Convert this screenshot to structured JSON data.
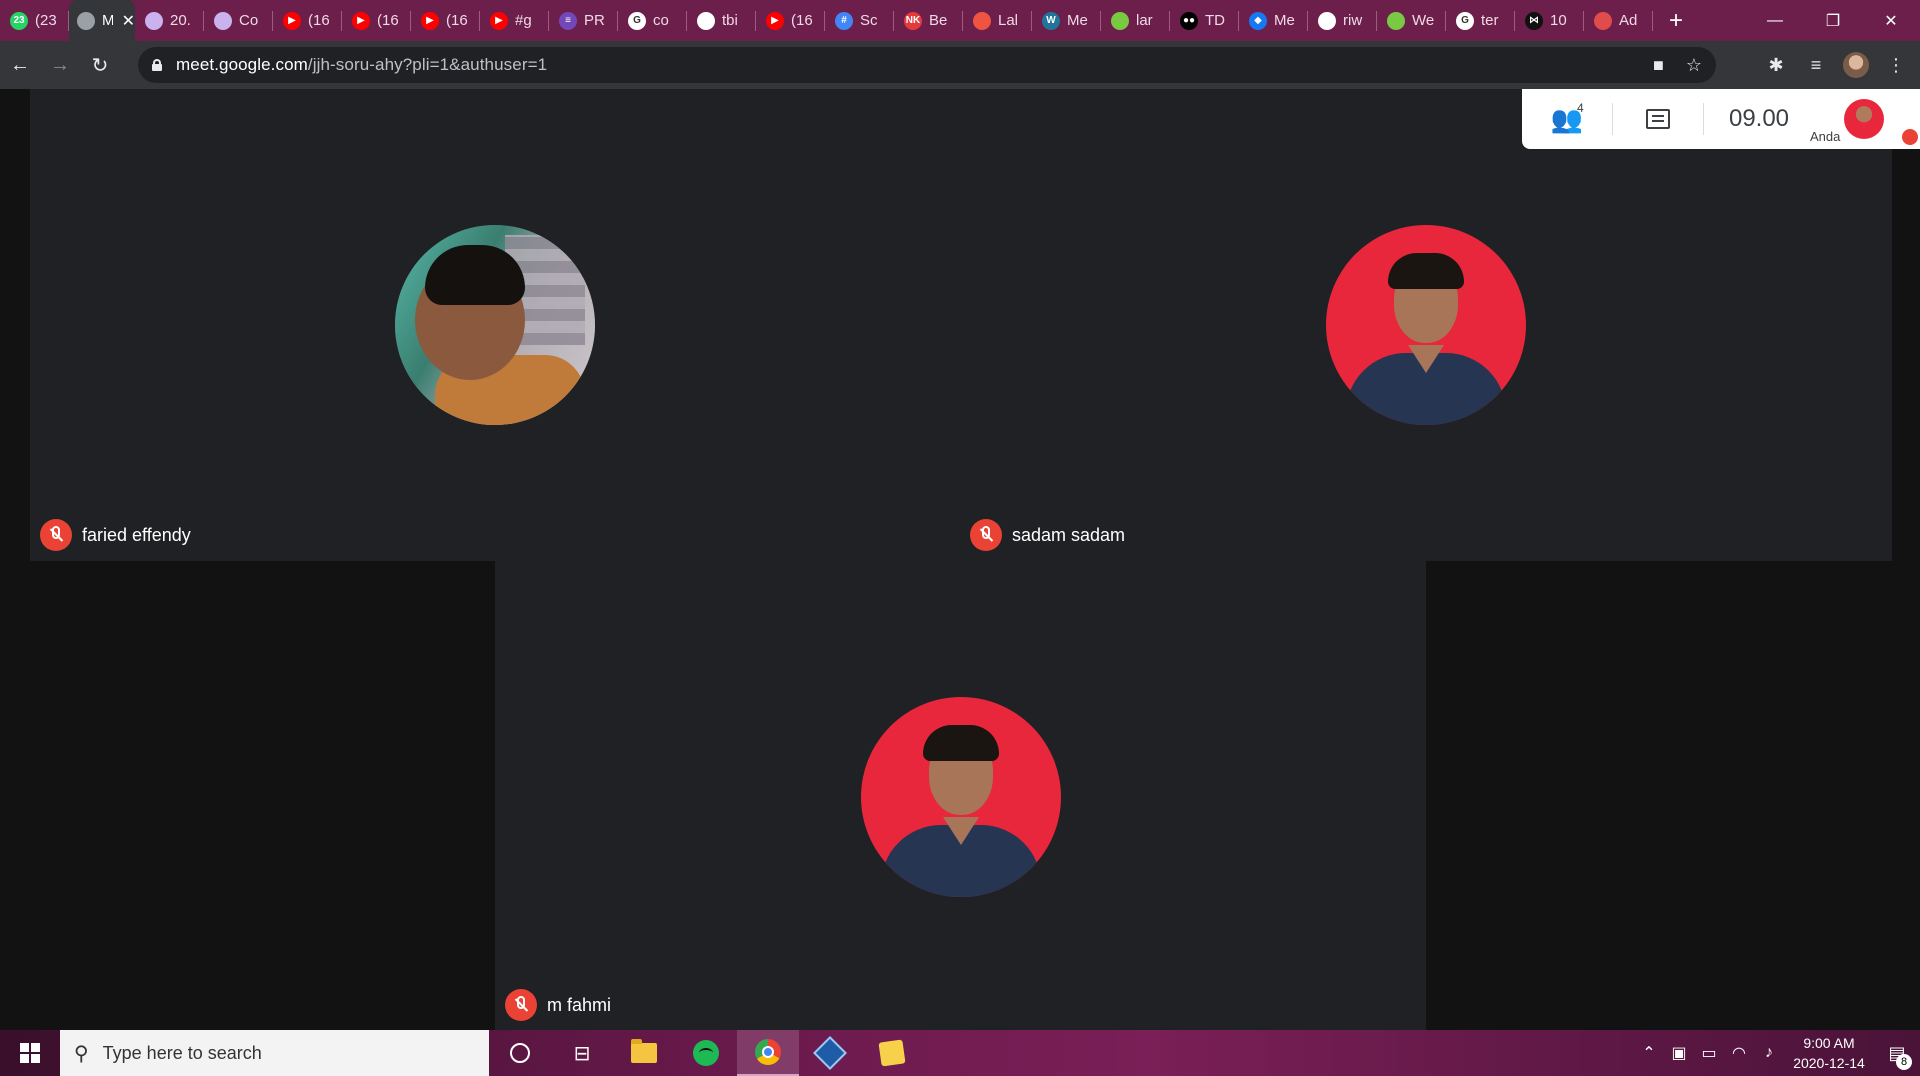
{
  "browser": {
    "tabs": [
      {
        "label": "(23",
        "icon": "whatsapp-icon",
        "color": "#25d366",
        "glyph": "23"
      },
      {
        "label": "M",
        "icon": "recording-icon",
        "color": "#9aa0a6",
        "glyph": "",
        "active": true
      },
      {
        "label": "20.",
        "icon": "app-icon",
        "color": "#c9b2ee",
        "glyph": ""
      },
      {
        "label": "Co",
        "icon": "app-icon",
        "color": "#c9b2ee",
        "glyph": ""
      },
      {
        "label": "(16",
        "icon": "youtube-icon",
        "color": "#ff0000",
        "glyph": "▶"
      },
      {
        "label": "(16",
        "icon": "youtube-icon",
        "color": "#ff0000",
        "glyph": "▶"
      },
      {
        "label": "(16",
        "icon": "youtube-icon",
        "color": "#ff0000",
        "glyph": "▶"
      },
      {
        "label": "#g",
        "icon": "youtube-icon",
        "color": "#ff0000",
        "glyph": "▶"
      },
      {
        "label": "PR",
        "icon": "forms-icon",
        "color": "#7248b9",
        "glyph": "≡"
      },
      {
        "label": "co",
        "icon": "google-icon",
        "color": "#ffffff",
        "glyph": "G"
      },
      {
        "label": "tbi",
        "icon": "github-icon",
        "color": "#ffffff",
        "glyph": ""
      },
      {
        "label": "(16",
        "icon": "youtube-icon",
        "color": "#ff0000",
        "glyph": "▶"
      },
      {
        "label": "Sc",
        "icon": "table-icon",
        "color": "#4285f4",
        "glyph": "#"
      },
      {
        "label": "Be",
        "icon": "nk-icon",
        "color": "#e33b3b",
        "glyph": "NK"
      },
      {
        "label": "Lal",
        "icon": "laravel-icon",
        "color": "#f05340",
        "glyph": ""
      },
      {
        "label": "Me",
        "icon": "wordpress-icon",
        "color": "#21759b",
        "glyph": "W"
      },
      {
        "label": "lar",
        "icon": "app-icon",
        "color": "#7ac943",
        "glyph": ""
      },
      {
        "label": "TD",
        "icon": "medium-icon",
        "color": "#000000",
        "glyph": "●●"
      },
      {
        "label": "Me",
        "icon": "diamond-icon",
        "color": "#1877f2",
        "glyph": "◆"
      },
      {
        "label": "riw",
        "icon": "github-icon",
        "color": "#ffffff",
        "glyph": ""
      },
      {
        "label": "We",
        "icon": "app-icon",
        "color": "#7ac943",
        "glyph": ""
      },
      {
        "label": "ter",
        "icon": "google-icon",
        "color": "#ffffff",
        "glyph": "G"
      },
      {
        "label": "10",
        "icon": "bowtie-icon",
        "color": "#111111",
        "glyph": "⋈"
      },
      {
        "label": "Ad",
        "icon": "app-icon",
        "color": "#e04b4b",
        "glyph": ""
      }
    ],
    "url_host": "meet.google.com",
    "url_path": "/jjh-soru-ahy?pli=1&authuser=1"
  },
  "meet": {
    "participants": [
      {
        "name": "faried effendy",
        "muted": true
      },
      {
        "name": "sadam sadam",
        "muted": true
      },
      {
        "name": "m fahmi",
        "muted": true
      }
    ],
    "participant_count": "4",
    "time": "09.00",
    "self_label": "Anda"
  },
  "taskbar": {
    "search_placeholder": "Type here to search",
    "time": "9:00 AM",
    "date": "2020-12-14",
    "notification_count": "8"
  }
}
